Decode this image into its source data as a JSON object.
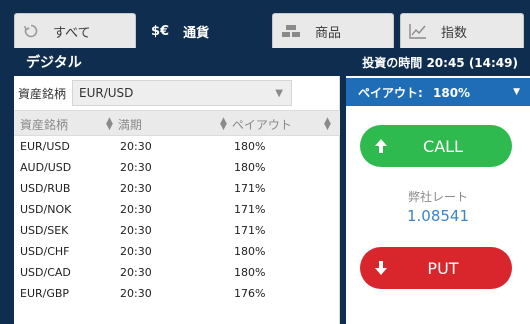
{
  "tabs": [
    {
      "icon": "history-icon",
      "label": "すべて"
    },
    {
      "icon_text": "$€",
      "label": "通貨"
    },
    {
      "icon": "bars-icon",
      "label": "商品"
    },
    {
      "icon": "index-chart-icon",
      "label": "指数"
    }
  ],
  "header": {
    "title": "デジタル",
    "time_text": "投資の時間 20:45 (14:49)"
  },
  "asset": {
    "label": "資産銘柄",
    "selected": "EUR/USD"
  },
  "table": {
    "columns": [
      "資産銘柄",
      "満期",
      "ペイアウト"
    ],
    "rows": [
      {
        "asset": "EUR/USD",
        "expiry": "20:30",
        "payout": "180%"
      },
      {
        "asset": "AUD/USD",
        "expiry": "20:30",
        "payout": "180%"
      },
      {
        "asset": "USD/RUB",
        "expiry": "20:30",
        "payout": "171%"
      },
      {
        "asset": "USD/NOK",
        "expiry": "20:30",
        "payout": "171%"
      },
      {
        "asset": "USD/SEK",
        "expiry": "20:30",
        "payout": "171%"
      },
      {
        "asset": "USD/CHF",
        "expiry": "20:30",
        "payout": "180%"
      },
      {
        "asset": "USD/CAD",
        "expiry": "20:30",
        "payout": "180%"
      },
      {
        "asset": "EUR/GBP",
        "expiry": "20:30",
        "payout": "176%"
      }
    ]
  },
  "payout": {
    "label": "ペイアウト:",
    "value": "180%"
  },
  "buttons": {
    "call": "CALL",
    "put": "PUT"
  },
  "rate": {
    "label": "弊社レート",
    "value": "1.08541"
  },
  "colors": {
    "navy": "#0f2e4f",
    "call_green": "#2fba4f",
    "put_red": "#d9262c",
    "payout_blue": "#1f6db6",
    "rate_blue": "#3a86c8"
  }
}
